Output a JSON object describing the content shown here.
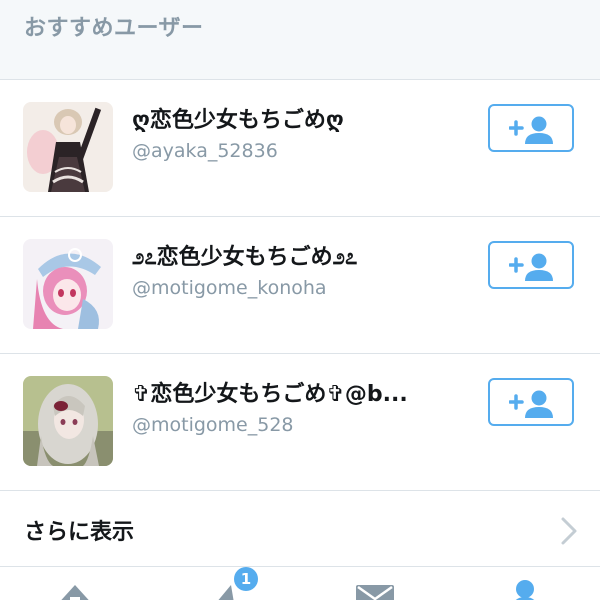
{
  "section": {
    "title": "おすすめユーザー"
  },
  "users": [
    {
      "display_name": "ღ恋色少女もちごめღ",
      "handle": "@ayaka_52836",
      "avatar_icon": "anime-girl-black-dress-avatar"
    },
    {
      "display_name": "೨೭恋色少女もちごめ೨೭",
      "handle": "@motigome_konoha",
      "avatar_icon": "anime-girl-pink-hair-avatar"
    },
    {
      "display_name": "✞恋色少女もちごめ✞@b...",
      "handle": "@motigome_528",
      "avatar_icon": "anime-girl-silver-hair-avatar"
    }
  ],
  "follow_button_icon": "add-user-icon",
  "more": {
    "label": "さらに表示",
    "icon": "chevron-right-icon"
  },
  "tabbar": {
    "tabs": [
      {
        "icon": "home-icon"
      },
      {
        "icon": "notifications-icon",
        "badge": "1"
      },
      {
        "icon": "messages-icon"
      },
      {
        "icon": "profile-icon"
      }
    ]
  },
  "colors": {
    "accent": "#55acee",
    "header_bg": "#f5f8fa",
    "muted_text": "#8899a6",
    "primary_text": "#14171a",
    "divider": "#dde3e8"
  }
}
